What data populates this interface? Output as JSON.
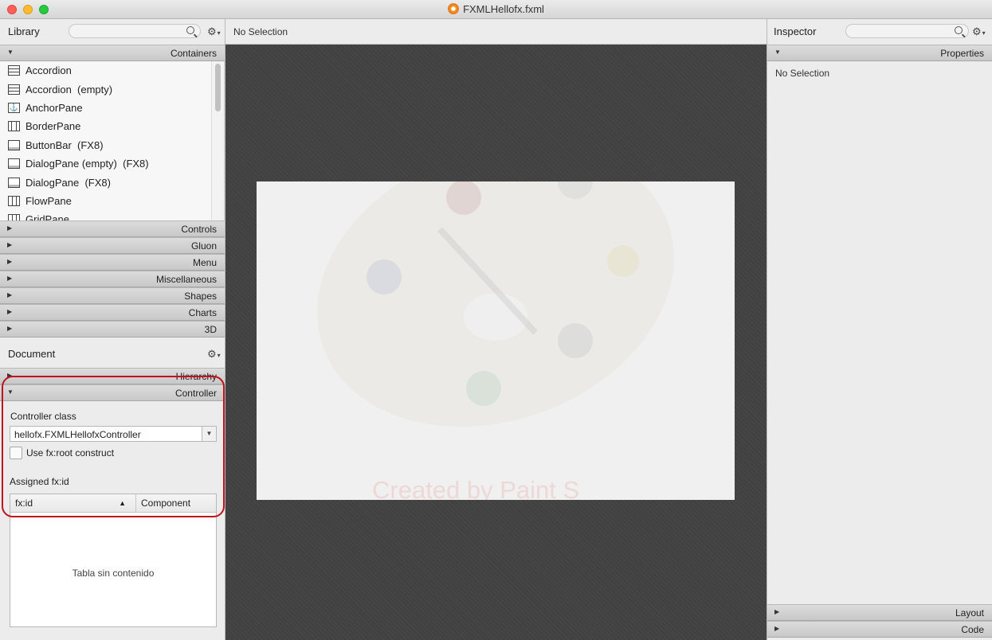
{
  "window": {
    "title": "FXMLHellofx.fxml"
  },
  "library": {
    "title": "Library",
    "search_placeholder": "",
    "sections": {
      "containers": "Containers",
      "controls": "Controls",
      "gluon": "Gluon",
      "menu": "Menu",
      "miscellaneous": "Miscellaneous",
      "shapes": "Shapes",
      "charts": "Charts",
      "three_d": "3D"
    },
    "items": [
      {
        "label": "Accordion",
        "icon": "accordion-icon"
      },
      {
        "label": "Accordion  (empty)",
        "icon": "accordion-icon"
      },
      {
        "label": "AnchorPane",
        "icon": "anchorpane-icon"
      },
      {
        "label": "BorderPane",
        "icon": "borderpane-icon"
      },
      {
        "label": "ButtonBar  (FX8)",
        "icon": "buttonbar-icon"
      },
      {
        "label": "DialogPane (empty)  (FX8)",
        "icon": "dialogpane-icon"
      },
      {
        "label": "DialogPane  (FX8)",
        "icon": "dialogpane-icon"
      },
      {
        "label": "FlowPane",
        "icon": "flowpane-icon"
      },
      {
        "label": "GridPane",
        "icon": "gridpane-icon"
      }
    ]
  },
  "document": {
    "title": "Document",
    "hierarchy": "Hierarchy",
    "controller": "Controller",
    "controller_class_label": "Controller class",
    "controller_class_value": "hellofx.FXMLHellofxController",
    "root_construct_label": "Use fx:root construct",
    "assigned_label": "Assigned fx:id",
    "table": {
      "col_fxid": "fx:id",
      "col_component": "Component",
      "empty": "Tabla sin contenido"
    }
  },
  "center": {
    "selection": "No Selection",
    "watermark": "Created by Paint S"
  },
  "inspector": {
    "title": "Inspector",
    "search_placeholder": "",
    "properties": "Properties",
    "no_selection": "No Selection",
    "layout": "Layout",
    "code": "Code"
  },
  "colors": {
    "highlight": "#c1121b",
    "canvas": "#404040"
  }
}
